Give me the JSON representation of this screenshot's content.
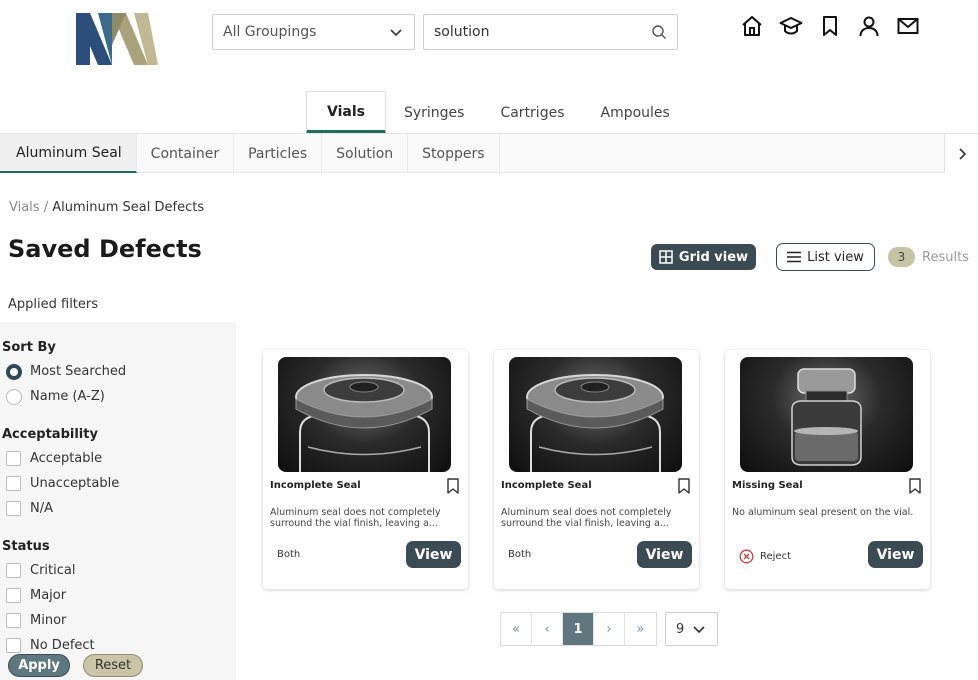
{
  "header": {
    "grouping_select": {
      "value": "All Groupings"
    },
    "search": {
      "value": "solution"
    },
    "icons": [
      "home-icon",
      "graduation-cap-icon",
      "bookmark-icon",
      "user-icon",
      "mail-icon"
    ]
  },
  "category_tabs": [
    "Vials",
    "Syringes",
    "Cartriges",
    "Ampoules"
  ],
  "sub_tabs": [
    "Aluminum Seal",
    "Container",
    "Particles",
    "Solution",
    "Stoppers"
  ],
  "breadcrumb": {
    "root": "Vials",
    "separator": "/",
    "current": "Aluminum Seal Defects"
  },
  "page_title": "Saved Defects",
  "view_toggle": {
    "grid": "Grid view",
    "list": "List view"
  },
  "results": {
    "count": "3",
    "label": "Results"
  },
  "filters": {
    "applied_label": "Applied filters",
    "sort_by": {
      "title": "Sort By",
      "options": [
        "Most Searched",
        "Name (A-Z)"
      ],
      "selected": "Most Searched"
    },
    "acceptability": {
      "title": "Acceptability",
      "options": [
        "Acceptable",
        "Unacceptable",
        "N/A"
      ]
    },
    "status": {
      "title": "Status",
      "options": [
        "Critical",
        "Major",
        "Minor",
        "No Defect"
      ]
    },
    "apply_label": "Apply",
    "reset_label": "Reset"
  },
  "cards": [
    {
      "title": "Incomplete Seal",
      "desc": "Aluminum seal does not completely surround the vial finish, leaving a...",
      "scope": "Both",
      "view": "View"
    },
    {
      "title": "Incomplete Seal",
      "desc": "Aluminum seal does not completely surround the vial finish, leaving a...",
      "scope": "Both",
      "view": "View"
    },
    {
      "title": "Missing Seal",
      "desc": "No aluminum seal present on the vial.",
      "scope": "Reject",
      "view": "View"
    }
  ],
  "pagination": {
    "first": "«",
    "prev": "‹",
    "current": "1",
    "next": "›",
    "last": "»",
    "per_page": "9"
  },
  "colors": {
    "accent": "#1f6f5c",
    "dark": "#3b4b53",
    "muted_gold": "#c7c3a4"
  }
}
